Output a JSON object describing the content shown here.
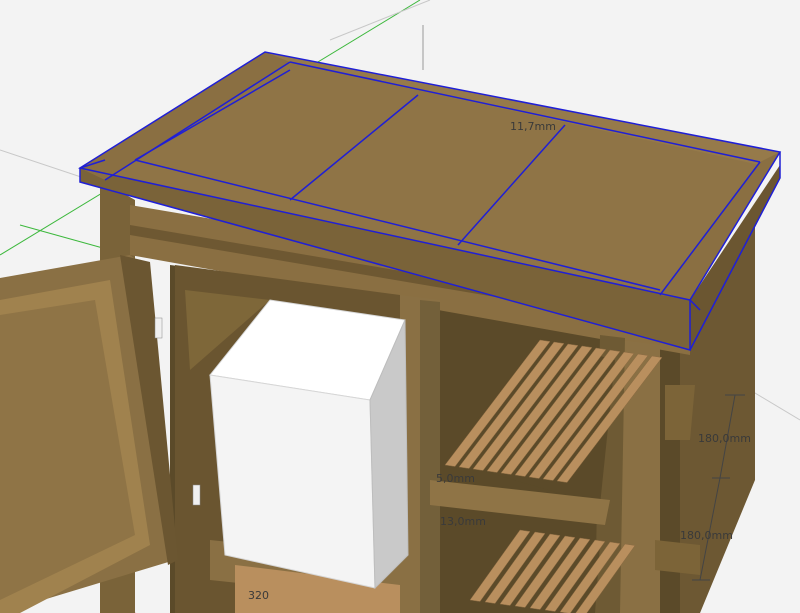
{
  "dimensions": {
    "top_thickness": "11,7mm",
    "shelf_spacing_upper": "180,0mm",
    "shelf_spacing_lower": "180,0mm",
    "partial_a": "5,0mm",
    "partial_b": "13,0mm",
    "partial_c": "320"
  },
  "colors": {
    "wood_top": "#8f7446",
    "wood_front": "#7f683e",
    "wood_dark": "#5b4a29",
    "wood_shadow": "#4a3c21",
    "shelf": "#b98f5e",
    "selection": "#1f1fd6",
    "background": "#f3f3f3",
    "box_face": "#f4f4f4",
    "box_side": "#c9c9c9"
  },
  "model": {
    "selected_component": "tabletop",
    "axis_green": "#3cb83c",
    "axis_red": "#d04040"
  }
}
